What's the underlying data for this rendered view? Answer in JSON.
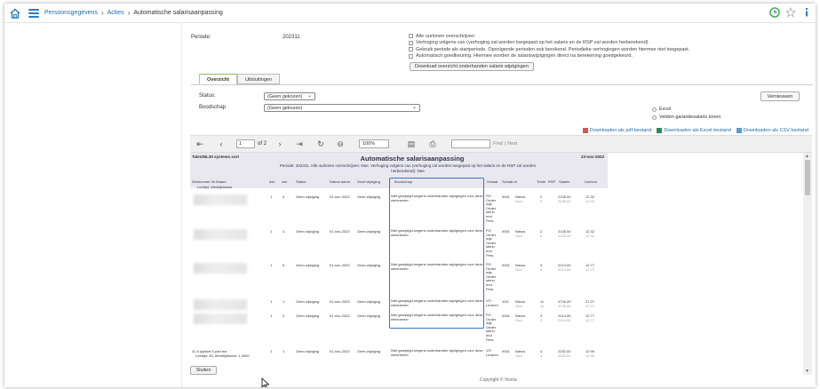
{
  "topbar": {
    "breadcrumbs": [
      "Persoonsgegevens",
      "Acties",
      "Automatische salarisaanpassing"
    ],
    "home_icon": "home-icon",
    "menu_icon": "hamburger-icon"
  },
  "form": {
    "periode_label": "Periode:",
    "periode_value": "202311",
    "options": [
      "Alle uurlonen overschrijven",
      "Verhoging volgens cao (verhoging zal worden toegepast op het salaris en de RSP zal worden herberekend)",
      "Gebruik periode als startperiode. Opvolgende perioden ook berekend. Periodieke verhogingen worden hiermee niet toegepast.",
      "Automatisch goedkeuring. Hiermee worden de salariswijzigingen direct na berekening goedgekeurd."
    ],
    "download_overview_label": "Download overzicht onderhanden salaris wijzigingen",
    "tabs": [
      "Overzicht",
      "Uitsluitingen"
    ],
    "status_label": "Status:",
    "status_value": "(Geen gekozen)",
    "boodschap_label": "Boodschap",
    "boodschap_value": "(Geen gekozen)",
    "refresh_label": "Vernieuwen",
    "excel_label": "Excel",
    "velden_label": "Velden garantiesalaris tonen",
    "downloads": [
      "Downloaden als pdf-bestand",
      "Downloaden als Excel-bestand",
      "Downloaden als CSV bestand"
    ]
  },
  "viewer": {
    "page_value": "1",
    "page_of": "of 2",
    "zoom_value": "100%",
    "find_label": "Find",
    "next_label": "Next"
  },
  "report": {
    "left_header": "TalentNL30 systeem sort",
    "title": "Automatische salarisaanpassing",
    "date": "23-nov-2023",
    "subtitle": "Periode: 202311. Alle uurlonen overschrijven: Nee. Verhoging volgens cao (verhoging zal worden toegepast op het salaris en de RSP zal worden herberekend): Nee",
    "columns": [
      "Werknemer Nr./Naam",
      "dvb",
      "vsn",
      "Status",
      "Datum aanm.",
      "Soort wijziging",
      "Boodschap",
      "Schaal",
      "Schaal-id",
      "",
      "Trede",
      "RSP",
      "Salaris",
      "Uurloon"
    ],
    "sub_columns": "Leeftijd, Werktijdfactor",
    "rows": [
      {
        "dvb": "1",
        "vsn": "3",
        "status": "Geen wijziging",
        "datum": "01-nov-2023",
        "soort": "Geen wijziging",
        "msg": "Niet gewijzigd wegens onderhanden wijzigingen voor deze werknemer",
        "schaal": "PO Onder wijs Onder steun end Pers.",
        "id": "0001",
        "nw": "Nieuw",
        "oud": "Oud",
        "trede": "2",
        "trede2": "2",
        "sal": "2135.00",
        "sal2": "2135.00",
        "uur": "12.32",
        "uur2": "12.32"
      },
      {
        "dvb": "1",
        "vsn": "4",
        "status": "Geen wijziging",
        "datum": "01-nov-2023",
        "soort": "Geen wijziging",
        "msg": "Niet gewijzigd wegens onderhanden wijzigingen voor deze werknemer",
        "schaal": "PO Onder wijs Onder steun end Pers.",
        "id": "0001",
        "nw": "Nieuw",
        "oud": "Oud",
        "trede": "2",
        "trede2": "2",
        "sal": "2135.00",
        "sal2": "2135.00",
        "uur": "12.32",
        "uur2": "12.32"
      },
      {
        "dvb": "1",
        "vsn": "5",
        "status": "Geen wijziging",
        "datum": "01-nov-2023",
        "soort": "Geen wijziging",
        "msg": "Niet gewijzigd wegens onderhanden wijzigingen voor deze werknemer",
        "schaal": "PO Onder wijs Onder steun end Pers.",
        "id": "0001",
        "nw": "Nieuw",
        "oud": "Oud",
        "trede": "3",
        "trede2": "3",
        "sal": "2214.00",
        "sal2": "2214.00",
        "uur": "12.77",
        "uur2": "12.77"
      },
      {
        "dvb": "1",
        "vsn": "1",
        "status": "Geen wijziging",
        "datum": "01-nov-2023",
        "soort": "Geen wijziging",
        "msg": "Niet gewijzigd wegens onderhanden wijzigingen voor deze werknemer",
        "schaal": "VO Leraren",
        "id": "10G",
        "nw": "Nieuw",
        "oud": "Oud",
        "trede": "11",
        "trede2": "11",
        "sal": "4726.00",
        "sal2": "4726.00",
        "uur": "27.27",
        "uur2": "27.27"
      },
      {
        "dvb": "1",
        "vsn": "2",
        "status": "Geen wijziging",
        "datum": "01-nov-2023",
        "soort": "Geen wijziging",
        "msg": "Niet gewijzigd wegens onderhanden wijzigingen voor deze werknemer",
        "schaal": "PO Onder wijs Onder steun end Pers.",
        "id": "0001",
        "nw": "Nieuw",
        "oud": "Oud",
        "trede": "3",
        "trede2": "3",
        "sal": "2214.00",
        "sal2": "2214.00",
        "uur": "12.77",
        "uur2": "12.77"
      },
      {
        "dvb": "1",
        "vsn": "1",
        "status": "Geen wijziging",
        "datum": "01-nov-2023",
        "soort": "Geen wijziging",
        "msg": "Niet gewijzigd wegens onderhanden wijzigingen voor deze werknemer",
        "schaal": "VO Leraren",
        "id": "0001",
        "nw": "Nieuw",
        "oud": "Oud",
        "trede": "4",
        "trede2": "4",
        "sal": "2252.00",
        "sal2": "2252.00",
        "uur": "12.99",
        "uur2": "12.99",
        "name": "41 A (spilsel?) pari tea",
        "sub": "Leeftijd: 35, Werktijdfactor: 1,0000"
      }
    ]
  },
  "footer": {
    "close_label": "Sluiten",
    "copyright": "Copyright © Visma"
  }
}
